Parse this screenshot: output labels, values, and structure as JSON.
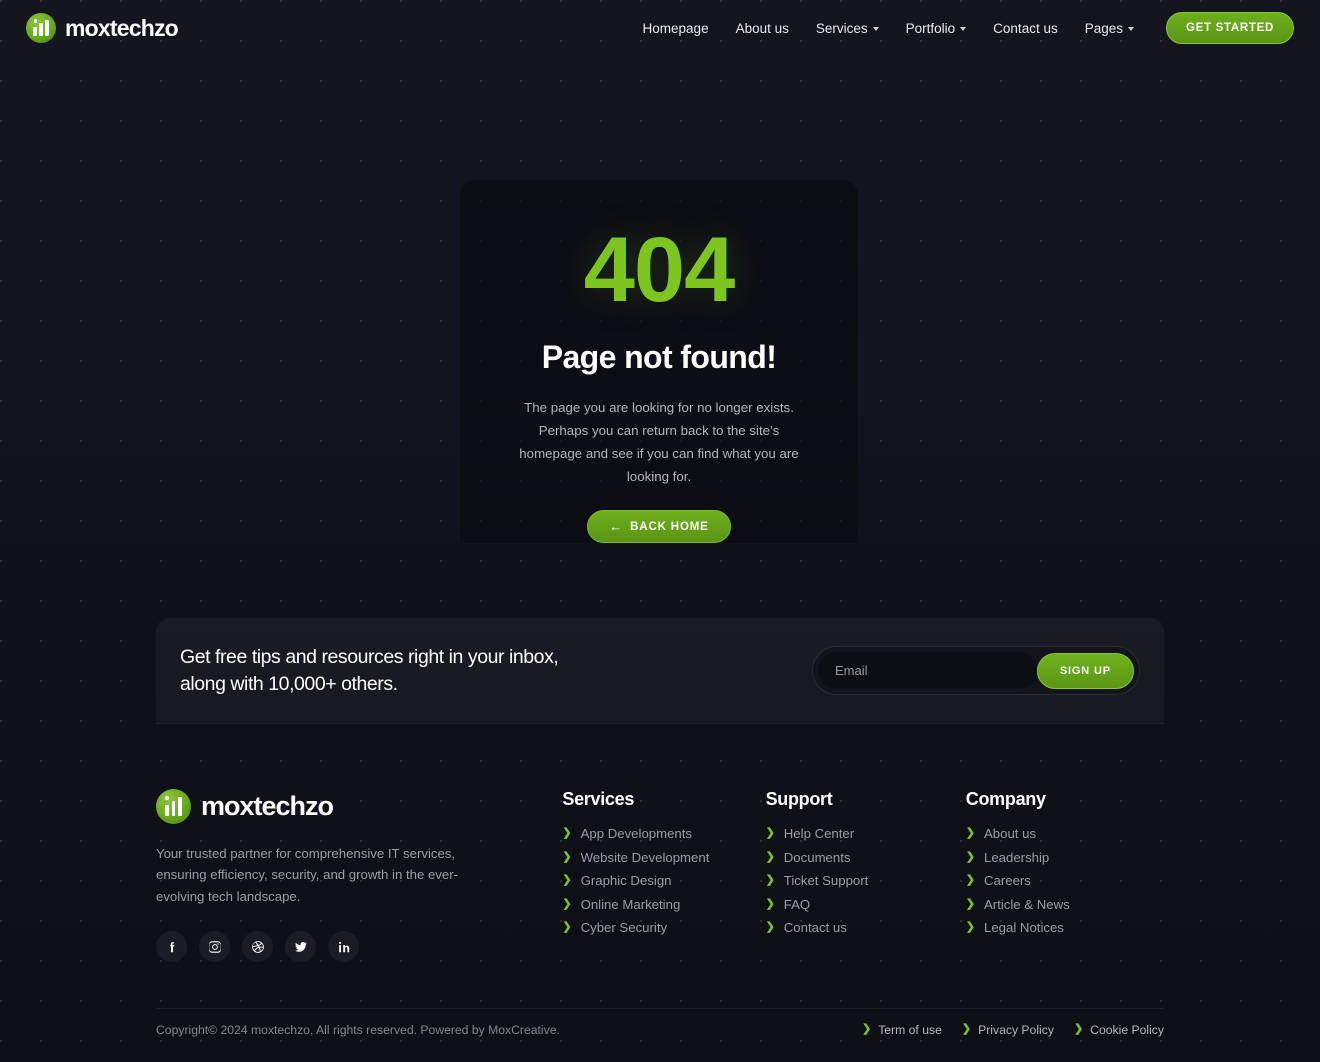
{
  "brand": {
    "name": "moxtechzo"
  },
  "header": {
    "nav": [
      {
        "label": "Homepage",
        "dropdown": false
      },
      {
        "label": "About us",
        "dropdown": false
      },
      {
        "label": "Services",
        "dropdown": true
      },
      {
        "label": "Portfolio",
        "dropdown": true
      },
      {
        "label": "Contact us",
        "dropdown": false
      },
      {
        "label": "Pages",
        "dropdown": true
      }
    ],
    "cta_label": "GET STARTED"
  },
  "error_page": {
    "code": "404",
    "title": "Page not found!",
    "description": "The page you are looking for no longer exists. Perhaps you can return back to the site's homepage and see if you can find what you are looking for.",
    "button_label": "BACK HOME",
    "button_arrow": "←"
  },
  "newsletter": {
    "heading_line1": "Get free tips and resources right in your inbox,",
    "heading_line2": "along with 10,000+ others.",
    "input_placeholder": "Email",
    "input_value": "",
    "submit_label": "SIGN UP"
  },
  "footer": {
    "tagline": "Your trusted partner for comprehensive IT services, ensuring efficiency, security, and growth in the ever-evolving tech landscape.",
    "socials": [
      {
        "name": "facebook-icon"
      },
      {
        "name": "instagram-icon"
      },
      {
        "name": "dribbble-icon"
      },
      {
        "name": "twitter-icon"
      },
      {
        "name": "linkedin-icon"
      }
    ],
    "columns": [
      {
        "title": "Services",
        "links": [
          "App Developments",
          "Website Development",
          "Graphic Design",
          "Online Marketing",
          "Cyber Security"
        ]
      },
      {
        "title": "Support",
        "links": [
          "Help Center",
          "Documents",
          "Ticket Support",
          "FAQ",
          "Contact us"
        ]
      },
      {
        "title": "Company",
        "links": [
          "About us",
          "Leadership",
          "Careers",
          "Article & News",
          "Legal Notices"
        ]
      }
    ],
    "copyright": "Copyright© 2024 moxtechzo, All rights reserved. Powered by MoxCreative.",
    "legal_links": [
      "Term of use",
      "Privacy Policy",
      "Cookie Policy"
    ]
  },
  "colors": {
    "accent_green": "#7cc61f",
    "button_green": "#5b9416",
    "background": "#15151f",
    "panel": "#1b1b25",
    "text_muted": "#9d9da8"
  }
}
